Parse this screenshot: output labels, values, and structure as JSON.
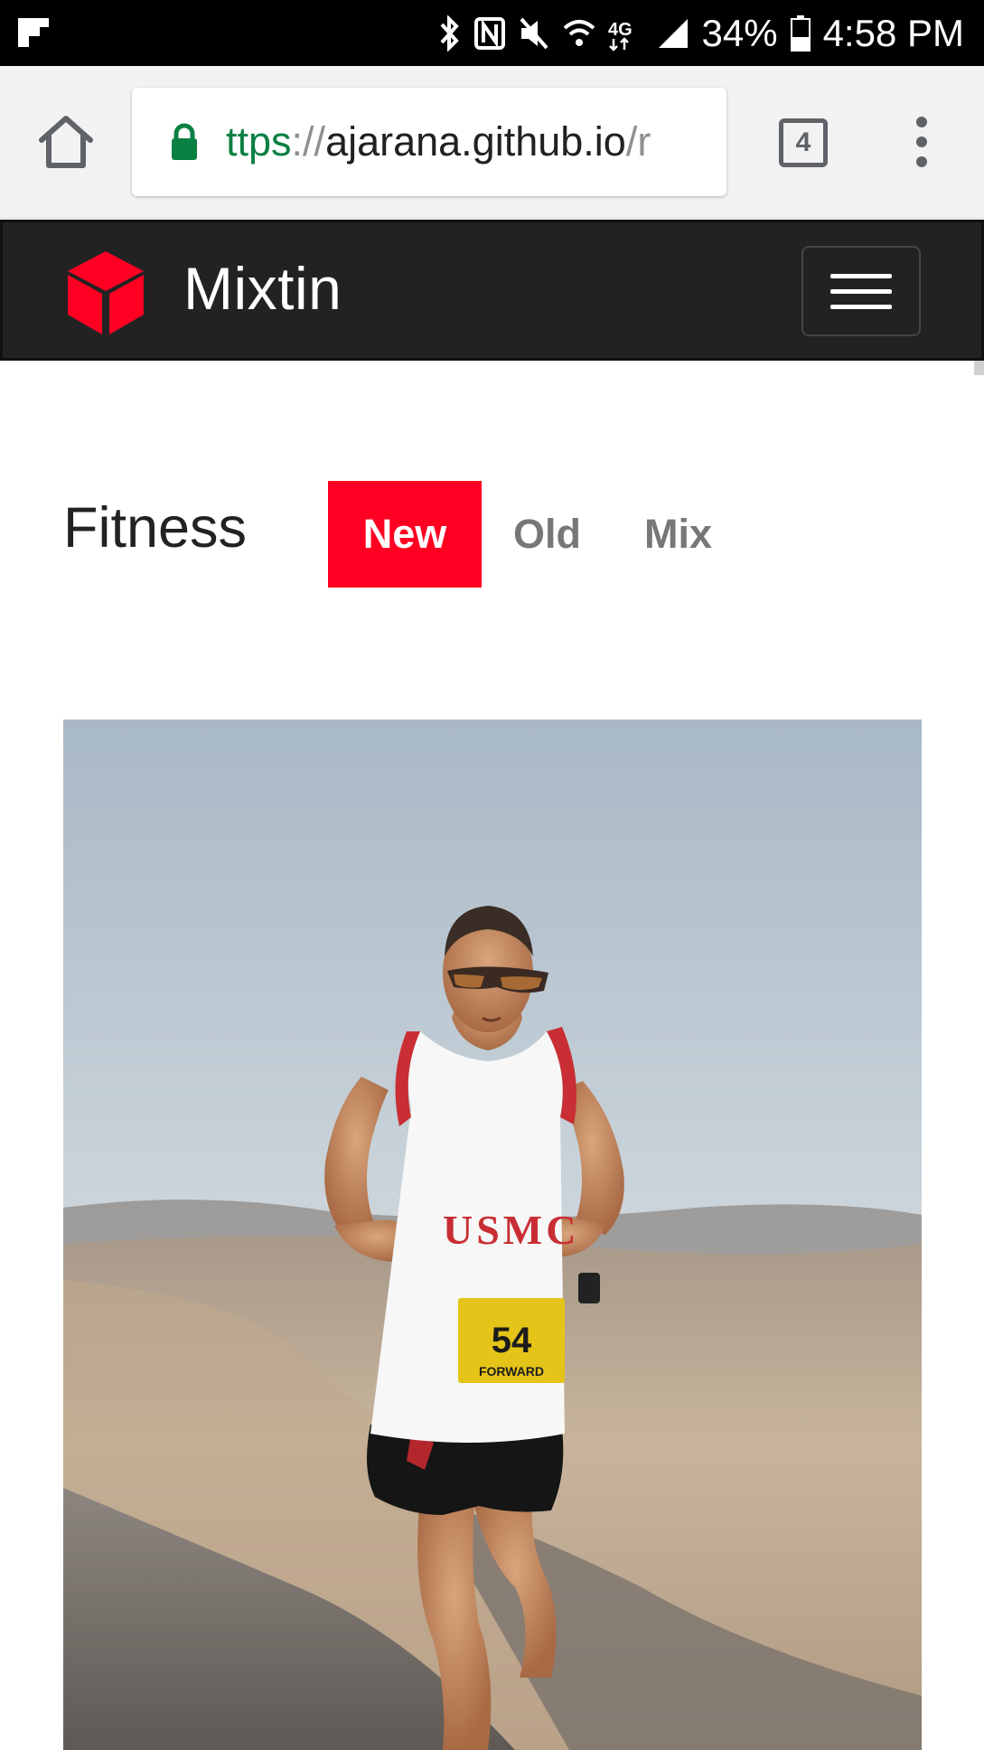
{
  "status_bar": {
    "battery": "34%",
    "time": "4:58 PM",
    "network": "4G LTE"
  },
  "browser": {
    "url_scheme": "ttps",
    "url_sep": "://",
    "url_host": "ajarana.github.io",
    "url_tail": "/r",
    "tab_count": "4"
  },
  "navbar": {
    "brand": "Mixtin"
  },
  "section": {
    "title": "Fitness",
    "filters": [
      {
        "label": "New",
        "active": true
      },
      {
        "label": "Old",
        "active": false
      },
      {
        "label": "Mix",
        "active": false
      }
    ]
  },
  "photo": {
    "shirt_text": "USMC",
    "bib_number": "54",
    "bib_sponsor": "FORWARD"
  },
  "colors": {
    "accent": "#ff0022",
    "navbar_bg": "#222222",
    "url_green": "#0b8043"
  }
}
